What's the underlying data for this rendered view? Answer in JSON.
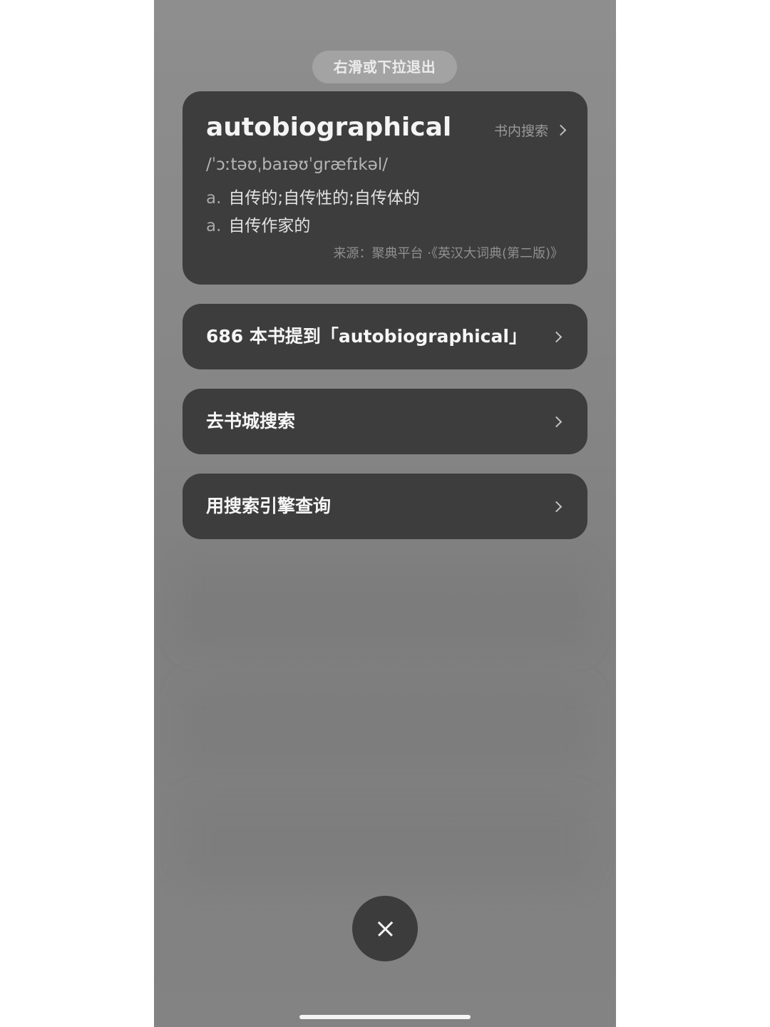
{
  "dismiss_hint": "右滑或下拉退出",
  "dictionary": {
    "word": "autobiographical",
    "in_book_search": "书内搜索",
    "phonetic": "/ˈɔːtəʊˌbaɪəʊˈɡræfɪkəl/",
    "definitions": [
      {
        "pos": "a.",
        "meaning": "自传的;自传性的;自传体的"
      },
      {
        "pos": "a.",
        "meaning": "自传作家的"
      }
    ],
    "source": "来源：聚典平台 ·《英汉大词典(第二版)》"
  },
  "actions": [
    {
      "label": "686 本书提到「autobiographical」"
    },
    {
      "label": "去书城搜索"
    },
    {
      "label": "用搜索引擎查询"
    }
  ],
  "icons": {
    "close": "close-icon",
    "chevron": "chevron-right-icon"
  },
  "colors": {
    "card_bg": "#3d3d3d",
    "backdrop": "#888888",
    "pill_bg": "#a3a3a3"
  }
}
